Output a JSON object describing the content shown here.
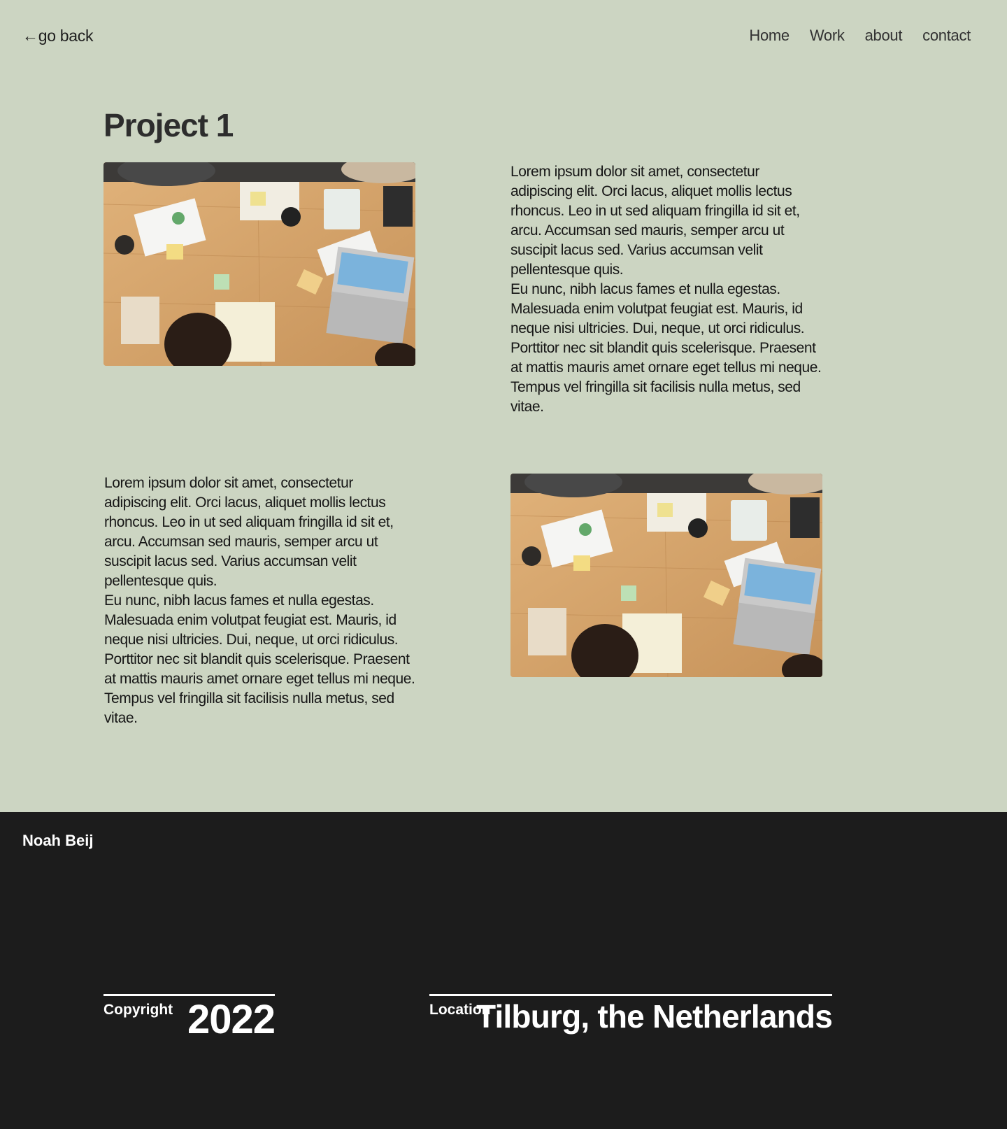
{
  "header": {
    "back_label": "←go back",
    "nav": [
      "Home",
      "Work",
      "about",
      "contact"
    ]
  },
  "page_title": "Project 1",
  "sections": [
    {
      "paragraphs": [
        "Lorem ipsum dolor sit amet, consectetur adipiscing elit. Orci lacus, aliquet mollis lectus rhoncus. Leo in ut sed aliquam fringilla id sit et, arcu. Accumsan sed mauris, semper arcu ut suscipit lacus sed. Varius accumsan velit pellentesque quis.",
        "Eu nunc, nibh lacus fames et nulla egestas. Malesuada enim volutpat feugiat est. Mauris, id neque nisi ultricies. Dui, neque, ut orci ridiculus. Porttitor nec sit blandit quis scelerisque. Praesent at mattis mauris amet ornare eget tellus mi neque. Tempus vel fringilla sit facilisis nulla metus, sed vitae."
      ]
    },
    {
      "paragraphs": [
        "Lorem ipsum dolor sit amet, consectetur adipiscing elit. Orci lacus, aliquet mollis lectus rhoncus. Leo in ut sed aliquam fringilla id sit et, arcu. Accumsan sed mauris, semper arcu ut suscipit lacus sed. Varius accumsan velit pellentesque quis.",
        "Eu nunc, nibh lacus fames et nulla egestas. Malesuada enim volutpat feugiat est. Mauris, id neque nisi ultricies. Dui, neque, ut orci ridiculus. Porttitor nec sit blandit quis scelerisque. Praesent at mattis mauris amet ornare eget tellus mi neque. Tempus vel fringilla sit facilisis nulla metus, sed vitae."
      ]
    }
  ],
  "footer": {
    "brand": "Noah Beij",
    "copyright_label": "Copyright",
    "copyright_year": "2022",
    "location_label": "Location",
    "location_value": "Tilburg, the Netherlands"
  },
  "colors": {
    "background": "#CCD5C2",
    "footer": "#1C1C1C",
    "text": "#1C1C1C"
  }
}
